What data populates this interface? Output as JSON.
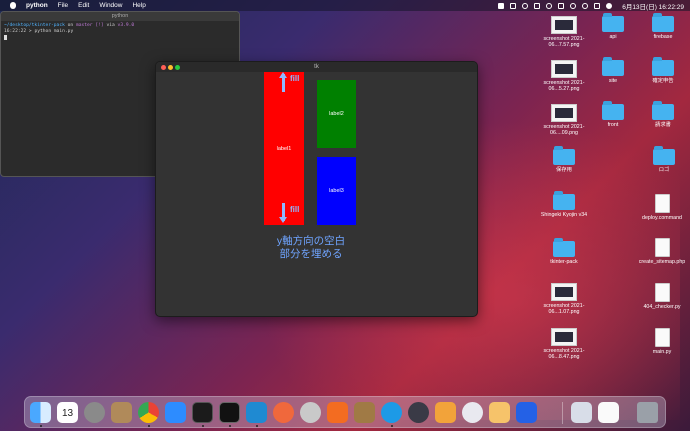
{
  "menubar": {
    "app": "python",
    "items": [
      "File",
      "Edit",
      "Window",
      "Help"
    ],
    "clock": "6月13日(日)  16:22:29"
  },
  "terminal": {
    "title": "python",
    "line1": {
      "path": "~/desktop/tkinter-pack",
      "on": "on",
      "branch": "master",
      "status": "[!]",
      "via": "via",
      "version": "v3.9.0"
    },
    "line2": {
      "time": "16:22:22",
      "prompt": ">",
      "command": "python main.py"
    }
  },
  "tk_window": {
    "title": "tk",
    "label1": "label1",
    "label2": "label2",
    "label3": "label3",
    "fill_top": "fill",
    "fill_bottom": "fill",
    "annotation_line1": "y軸方向の空白",
    "annotation_line2": "部分を埋める"
  },
  "desktop": {
    "col1": [
      {
        "name": "screenshot 2021-06...7.57.png"
      },
      {
        "name": "screenshot 2021-06...5.27.png"
      },
      {
        "name": "screenshot 2021-06....09.png"
      },
      {
        "name": "保存用"
      },
      {
        "name": "Shingeki Kyojin v34"
      },
      {
        "name": "tkinter-pack"
      },
      {
        "name": "screenshot 2021-06...1.07.png"
      },
      {
        "name": "screenshot 2021-06...8.47.png"
      }
    ],
    "col2": [
      {
        "name": "api"
      },
      {
        "name": "site"
      },
      {
        "name": "front"
      },
      {
        "name": "ロゴ"
      },
      {
        "name": "deploy.command"
      },
      {
        "name": "create_sitemap.php"
      },
      {
        "name": "404_checker.py"
      },
      {
        "name": "main.py"
      }
    ],
    "col3": [
      {
        "name": "firebase"
      },
      {
        "name": "確定申告"
      },
      {
        "name": "請求書"
      }
    ]
  },
  "dock": {
    "calendar_day": "13",
    "apps": [
      "finder",
      "calendar",
      "system-preferences",
      "folder",
      "chrome",
      "zoom",
      "terminal",
      "terminal-2",
      "vscode",
      "safari",
      "sequel",
      "analytics",
      "archive",
      "docker",
      "quicktime",
      "sourcetree",
      "github",
      "photo",
      "infinity",
      "preview",
      "document",
      "trash"
    ]
  }
}
